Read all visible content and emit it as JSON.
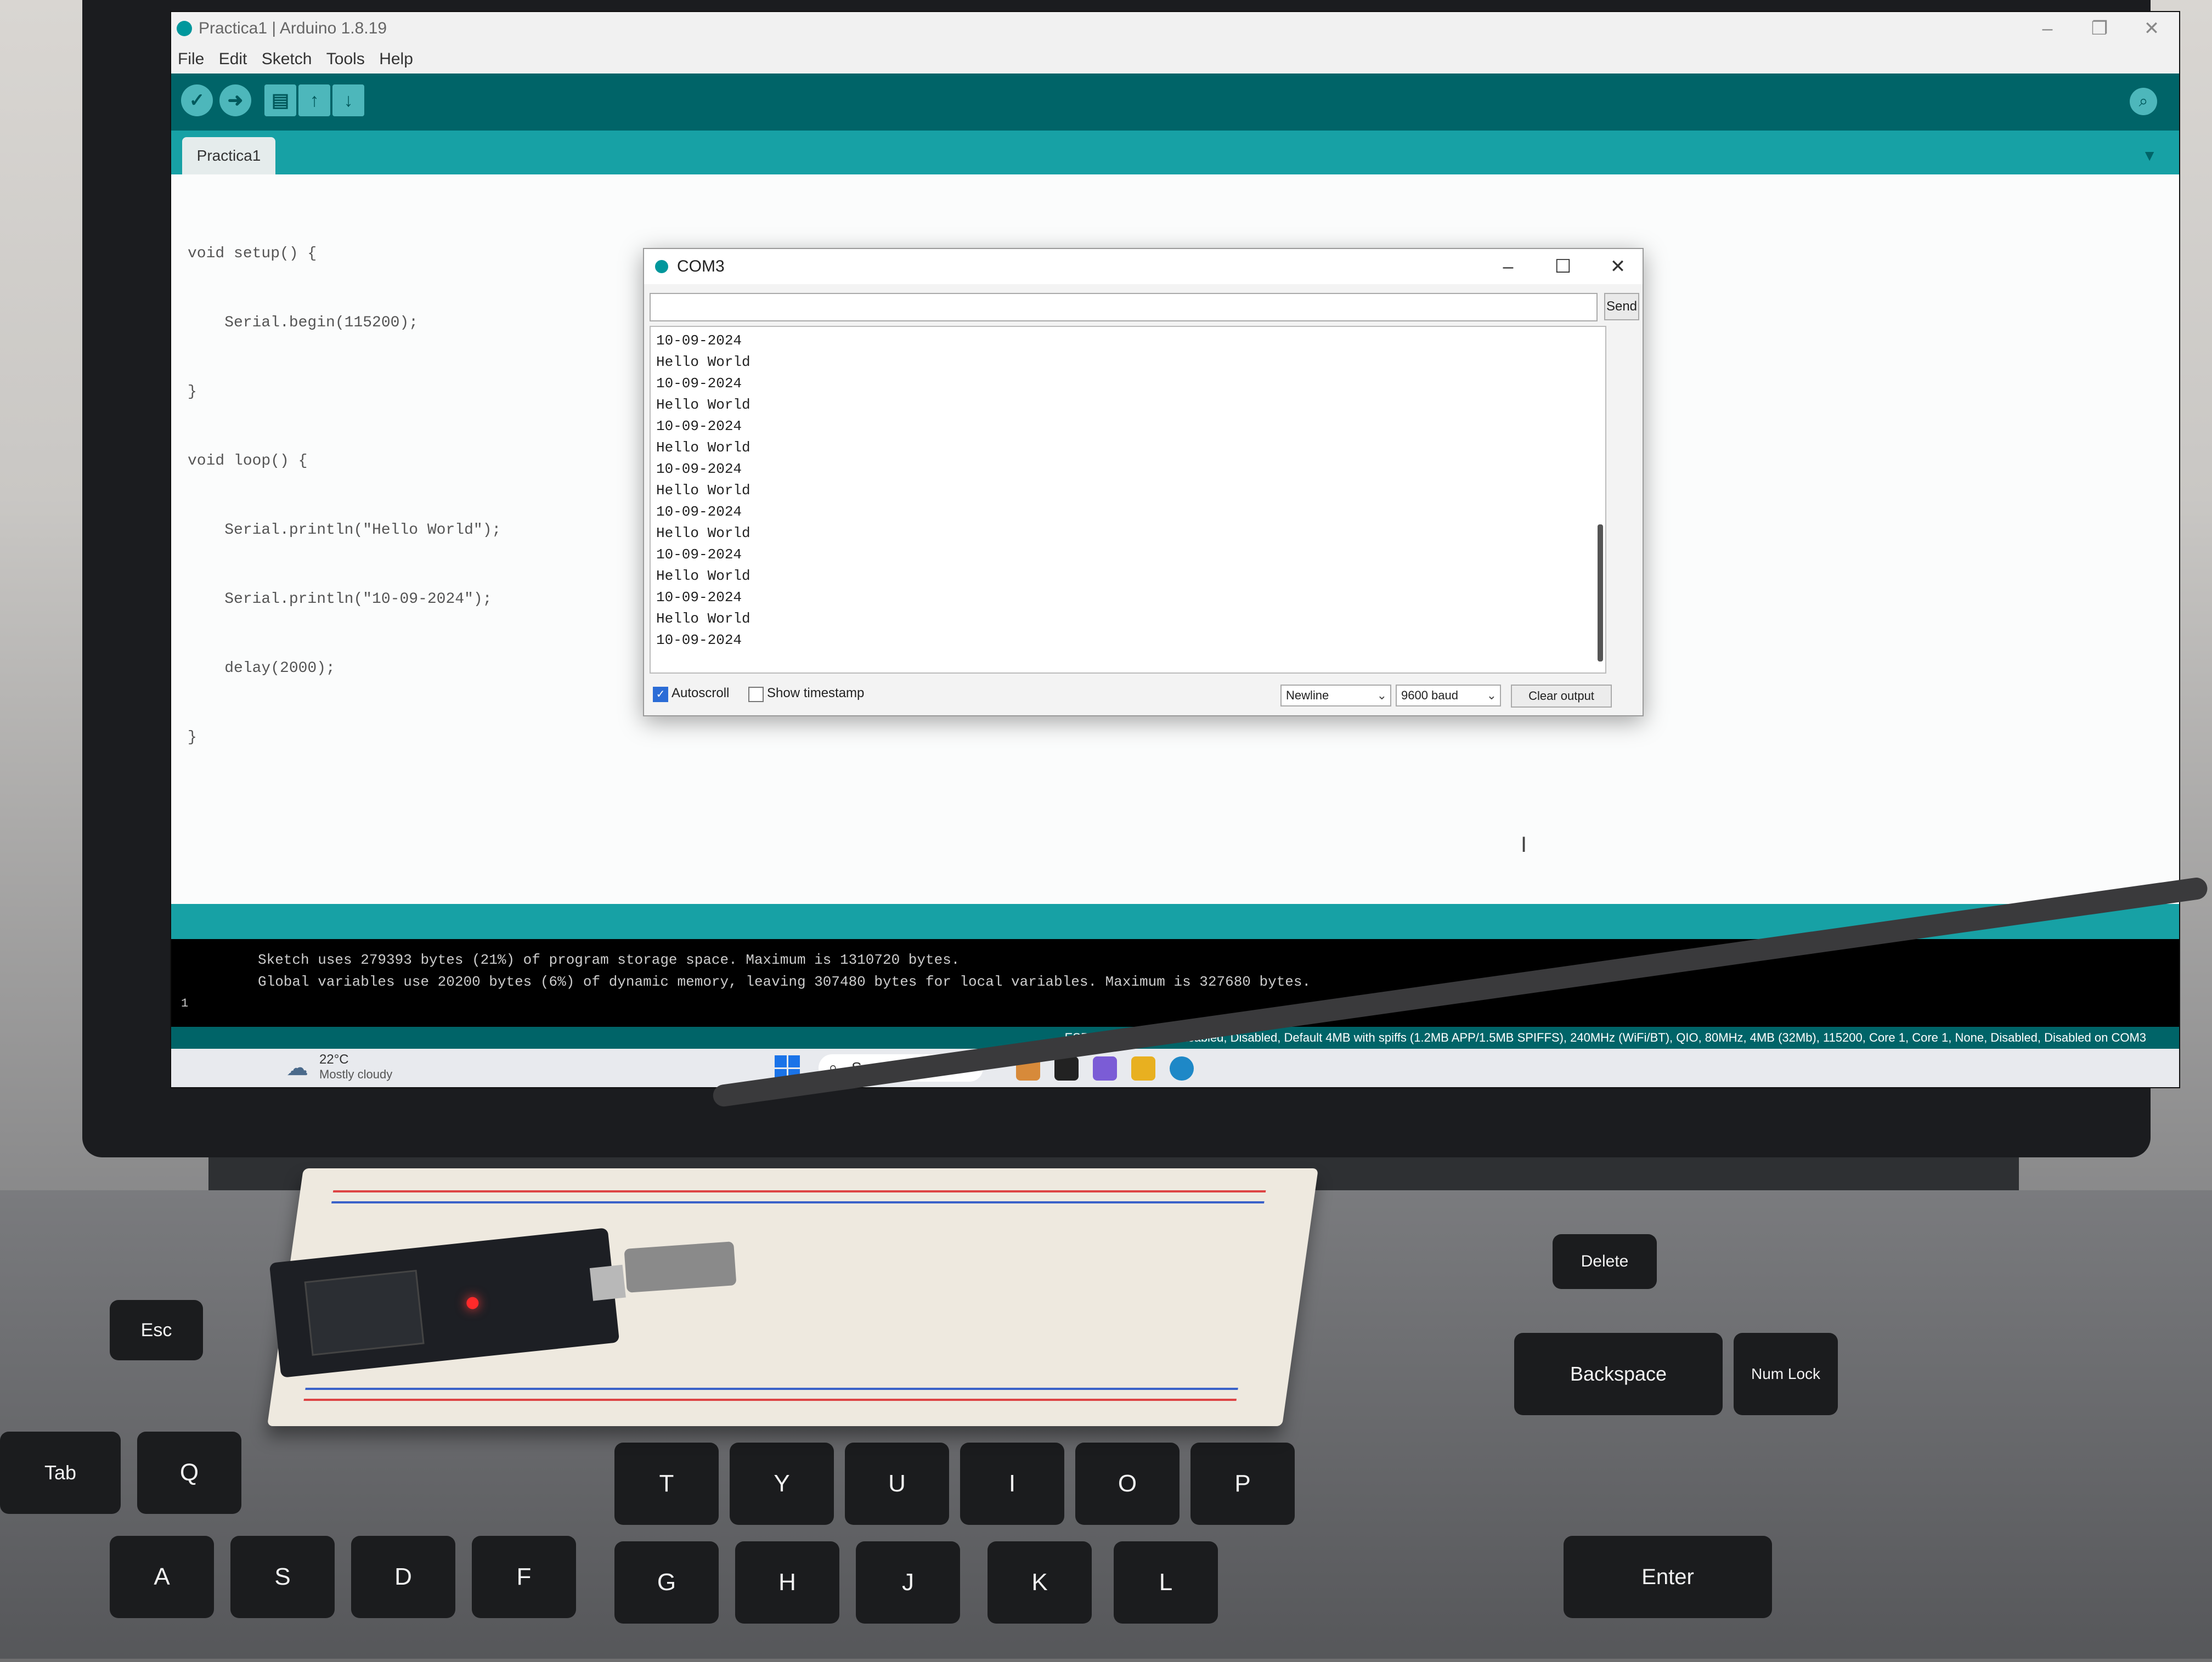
{
  "window": {
    "title": "Practica1 | Arduino 1.8.19",
    "minimize": "–",
    "maximize": "❐",
    "close": "✕"
  },
  "menu": [
    "File",
    "Edit",
    "Sketch",
    "Tools",
    "Help"
  ],
  "toolbar": {
    "verify_icon": "check-icon",
    "upload_icon": "arrow-right-icon",
    "new_icon": "file-icon",
    "open_icon": "arrow-up-icon",
    "save_icon": "arrow-down-icon",
    "serial_monitor_icon": "magnifier-icon"
  },
  "tabs": [
    {
      "label": "Practica1"
    }
  ],
  "code_lines": [
    "void setup() {",
    "    Serial.begin(115200);",
    "}",
    "void loop() {",
    "    Serial.println(\"Hello World\");",
    "    Serial.println(\"10-09-2024\");",
    "    delay(2000);",
    "}"
  ],
  "console": {
    "line1": "Sketch uses 279393 bytes (21%) of program storage space. Maximum is 1310720 bytes.",
    "line2": "Global variables use 20200 bytes (6%) of dynamic memory, leaving 307480 bytes for local variables. Maximum is 327680 bytes.",
    "line_number": "1"
  },
  "board_status": "ESP32 Dev Module, Disabled, Disabled, Default 4MB with spiffs (1.2MB APP/1.5MB SPIFFS), 240MHz (WiFi/BT), QIO, 80MHz, 4MB (32Mb), 115200, Core 1, Core 1, None, Disabled, Disabled on COM3",
  "serial_monitor": {
    "title": "COM3",
    "minimize": "–",
    "maximize": "☐",
    "close": "✕",
    "input_value": "",
    "send_label": "Send",
    "output": [
      "10-09-2024",
      "Hello World",
      "10-09-2024",
      "Hello World",
      "10-09-2024",
      "Hello World",
      "10-09-2024",
      "Hello World",
      "10-09-2024",
      "Hello World",
      "10-09-2024",
      "Hello World",
      "10-09-2024",
      "Hello World",
      "10-09-2024"
    ],
    "autoscroll_label": "Autoscroll",
    "autoscroll_checked": true,
    "timestamp_label": "Show timestamp",
    "timestamp_checked": false,
    "line_ending": "Newline",
    "baud": "9600 baud",
    "clear_label": "Clear output"
  },
  "taskbar": {
    "weather_temp": "22°C",
    "weather_desc": "Mostly cloudy",
    "search_label": "Search"
  },
  "keyboard": {
    "row_letters": [
      "Q",
      "T",
      "Y",
      "U",
      "I",
      "O",
      "P"
    ],
    "row_home": [
      "A",
      "S",
      "D",
      "F",
      "G",
      "H",
      "J",
      "K",
      "L"
    ],
    "extra": [
      "Esc",
      "Tab",
      "Backspace",
      "Delete",
      "Enter",
      "Num Lock"
    ]
  },
  "colors": {
    "arduino_teal_dark": "#006468",
    "arduino_teal": "#17a1a5",
    "led_red": "#ff2a2a"
  }
}
